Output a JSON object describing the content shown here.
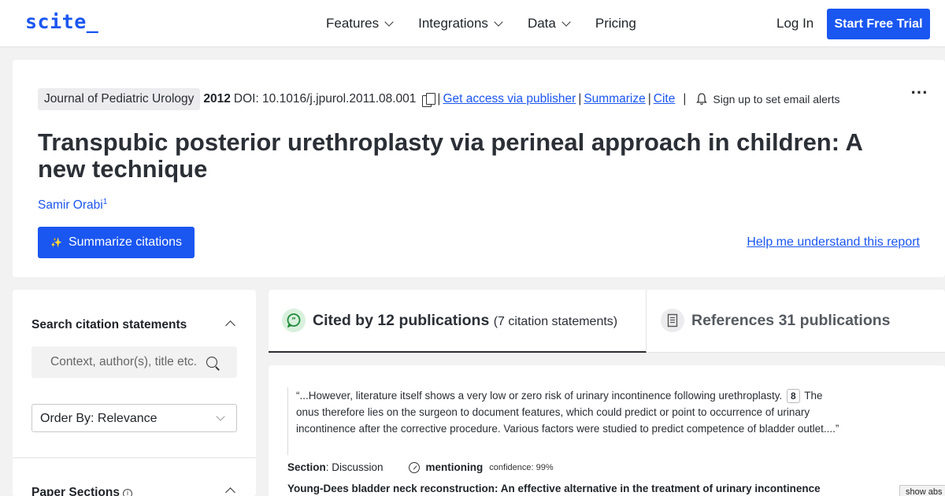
{
  "nav": {
    "logo": "scite_",
    "links": [
      "Features",
      "Integrations",
      "Data",
      "Pricing"
    ],
    "login": "Log In",
    "trial": "Start Free Trial"
  },
  "paper": {
    "journal": "Journal of Pediatric Urology",
    "year": "2012",
    "doi": "DOI: 10.1016/j.jpurol.2011.08.001",
    "access_link": "Get access via publisher",
    "summarize_link": "Summarize",
    "cite_link": "Cite",
    "alert_text": "Sign up to set email alerts",
    "title": "Transpubic posterior urethroplasty via perineal approach in children: A new technique",
    "author": "Samir Orabi",
    "author_sup": "1",
    "summarize_button": "Summarize citations",
    "help_link": "Help me understand this report"
  },
  "sidebar": {
    "search_title": "Search citation statements",
    "search_placeholder": "Context, author(s), title etc.",
    "order_by": "Order By: Relevance",
    "sections_title": "Paper Sections"
  },
  "tabs": {
    "cited_label": "Cited by 12 publications",
    "cited_sub": "(7 citation statements)",
    "references_label": "References 31 publications"
  },
  "citation": {
    "quote_part1": "“...However, literature itself shows a very low or zero risk of urinary incontinence following urethroplasty.",
    "ref_num": "8",
    "quote_part2": "The onus therefore lies on the surgeon to document features, which could predict or point to occurrence of urinary incontinence after the corrective procedure. Various factors were studied to predict competence of bladder outlet....”",
    "section_label": "Section",
    "section_value": ": Discussion",
    "type": "mentioning",
    "confidence": "confidence: 99%",
    "next_title": "Young-Dees bladder neck reconstruction: An effective alternative in the treatment of urinary incontinence",
    "show_abstract": "show abs"
  },
  "colors": {
    "brand": "#1a56f0",
    "cited_icon_bg": "#d9f0dd",
    "cited_icon_fg": "#1e8a3a"
  }
}
